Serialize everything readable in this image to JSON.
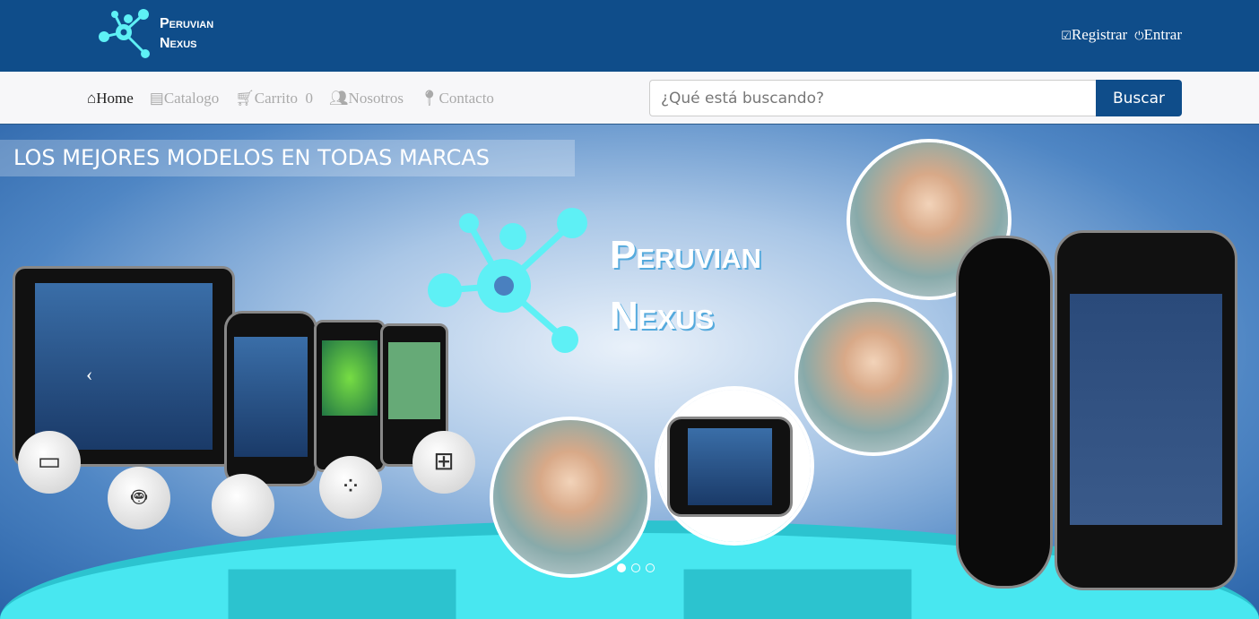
{
  "brand": {
    "name_line1": "Peruvian",
    "name_line2": "Nexus",
    "accent": "#5ef0f5"
  },
  "header": {
    "register": "Registrar",
    "login": "Entrar",
    "register_icon": "checkbox-icon",
    "login_icon": "power-icon"
  },
  "nav": {
    "items": [
      {
        "label": "Home",
        "icon": "home-icon"
      },
      {
        "label": "Catalogo",
        "icon": "catalog-icon"
      },
      {
        "label": "Carrito",
        "icon": "cart-icon",
        "count": "0"
      },
      {
        "label": "Nosotros",
        "icon": "users-icon"
      },
      {
        "label": "Contacto",
        "icon": "map-pin-icon"
      }
    ]
  },
  "search": {
    "placeholder": "¿Qué está buscando?",
    "value": "",
    "button": "Buscar"
  },
  "banner": {
    "tagline": "LOS MEJORES MODELOS EN TODAS MARCAS",
    "prev": "‹",
    "slides": 3,
    "active": 0
  },
  "colors": {
    "primary": "#0f4d8a",
    "nav_bg": "#f7f7f9"
  }
}
